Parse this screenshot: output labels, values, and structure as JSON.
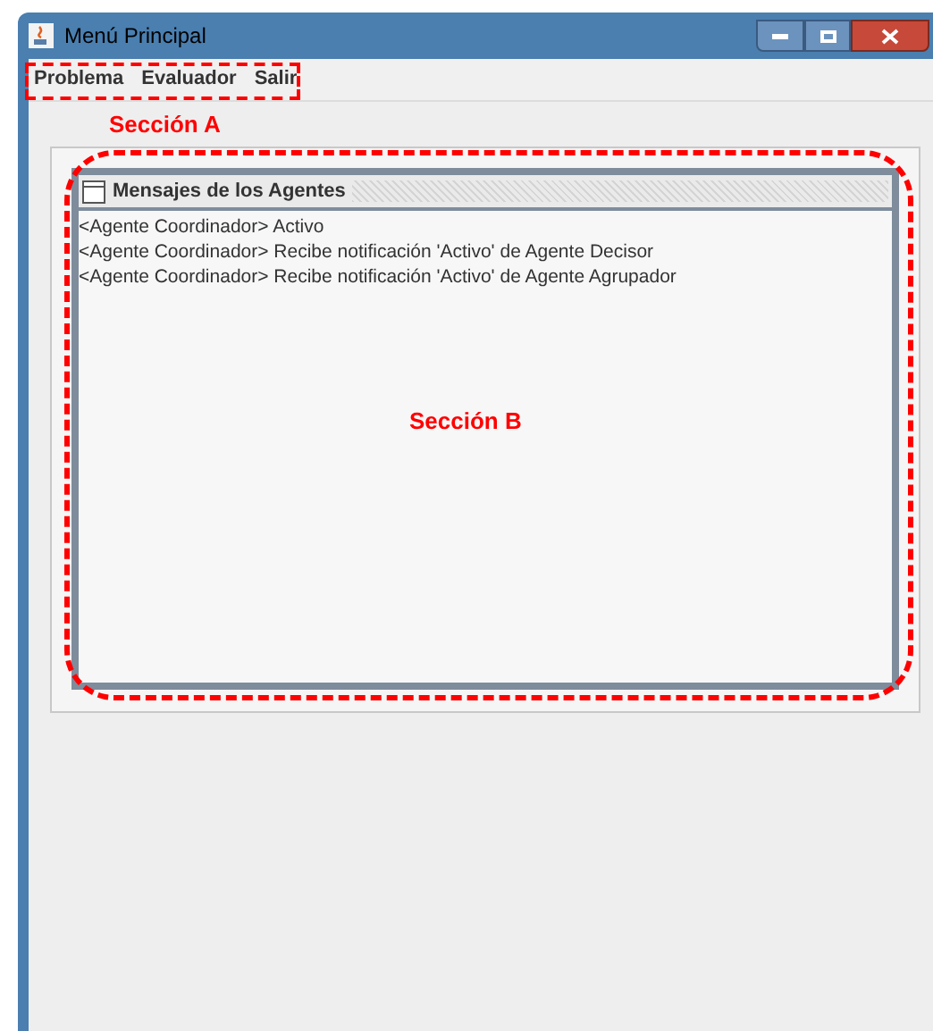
{
  "window": {
    "title": "Menú Principal"
  },
  "menu_bar": {
    "items": [
      {
        "label": "Problema"
      },
      {
        "label": "Evaluador"
      },
      {
        "label": "Salir"
      }
    ],
    "annotation": {
      "label": "Sección A"
    }
  },
  "internal_frame": {
    "title": "Mensajes de los Agentes",
    "messages": [
      "<Agente Coordinador> Activo",
      "<Agente Coordinador> Recibe notificación 'Activo' de Agente Decisor",
      "<Agente Coordinador> Recibe notificación 'Activo' de Agente Agrupador"
    ],
    "annotation": {
      "label": "Sección B"
    }
  }
}
